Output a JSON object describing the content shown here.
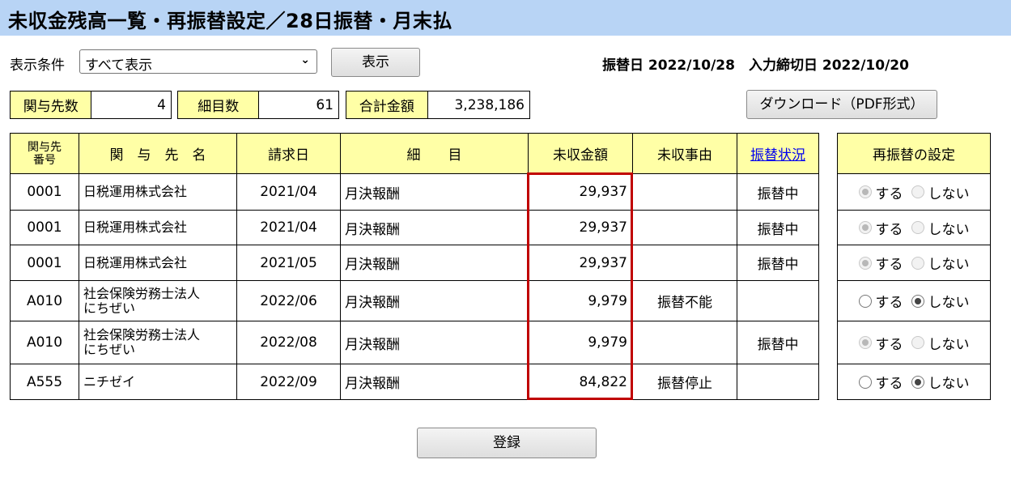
{
  "page": {
    "title": "未収金残高一覧・再振替設定／28日振替・月末払"
  },
  "filter": {
    "label": "表示条件",
    "selected": "すべて表示",
    "show_button": "表示"
  },
  "dates_text": "振替日 2022/10/28　入力締切日 2022/10/20",
  "summary": {
    "clients_label": "関与先数",
    "clients_value": "4",
    "items_label": "細目数",
    "items_value": "61",
    "total_label": "合計金額",
    "total_value": "3,238,186"
  },
  "download_button": "ダウンロード（PDF形式）",
  "table": {
    "headers": {
      "client_no": "関与先\n番号",
      "client_name": "関　与　先　名",
      "billing_date": "請求日",
      "item": "細　　目",
      "unpaid": "未収金額",
      "reason": "未収事由",
      "status": "振替状況"
    },
    "rows": [
      {
        "no": "0001",
        "name": "日税運用株式会社",
        "date": "2021/04",
        "item": "月決報酬",
        "amount": "29,937",
        "reason": "",
        "status": "振替中"
      },
      {
        "no": "0001",
        "name": "日税運用株式会社",
        "date": "2021/04",
        "item": "月決報酬",
        "amount": "29,937",
        "reason": "",
        "status": "振替中"
      },
      {
        "no": "0001",
        "name": "日税運用株式会社",
        "date": "2021/05",
        "item": "月決報酬",
        "amount": "29,937",
        "reason": "",
        "status": "振替中"
      },
      {
        "no": "A010",
        "name": "社会保険労務士法人\nにちぜい",
        "date": "2022/06",
        "item": "月決報酬",
        "amount": "9,979",
        "reason": "振替不能",
        "status": ""
      },
      {
        "no": "A010",
        "name": "社会保険労務士法人\nにちぜい",
        "date": "2022/08",
        "item": "月決報酬",
        "amount": "9,979",
        "reason": "",
        "status": "振替中"
      },
      {
        "no": "A555",
        "name": "ニチゼイ",
        "date": "2022/09",
        "item": "月決報酬",
        "amount": "84,822",
        "reason": "振替停止",
        "status": ""
      }
    ]
  },
  "refund": {
    "header": "再振替の設定",
    "yes": "する",
    "no": "しない",
    "rows": [
      {
        "selected": "yes",
        "disabled": true
      },
      {
        "selected": "yes",
        "disabled": true
      },
      {
        "selected": "yes",
        "disabled": true
      },
      {
        "selected": "no",
        "disabled": false
      },
      {
        "selected": "yes",
        "disabled": true
      },
      {
        "selected": "no",
        "disabled": false
      }
    ]
  },
  "register_button": "登録",
  "colors": {
    "title_bg": "#b8d4f5",
    "header_bg": "#ffffa6",
    "highlight": "#c00000",
    "link": "#0000ee"
  }
}
